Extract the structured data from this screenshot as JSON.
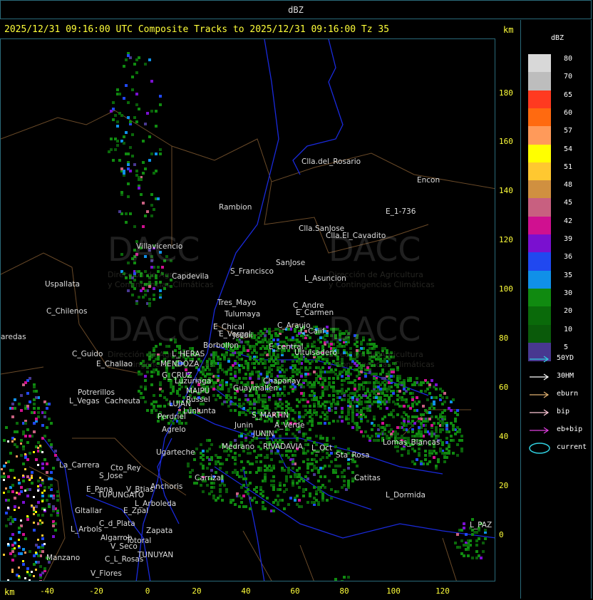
{
  "window_title": "dBZ",
  "header": "2025/12/31 09:16:00 UTC Composite Tracks to 2025/12/31 09:16:00 Tz 35",
  "km_label": "km",
  "y_ticks": [
    "180",
    "160",
    "140",
    "120",
    "100",
    "80",
    "60",
    "40",
    "20",
    "0"
  ],
  "x_ticks": [
    "-40",
    "-20",
    "0",
    "20",
    "40",
    "60",
    "80",
    "100",
    "120"
  ],
  "scale": {
    "title": "dBZ",
    "entries": [
      {
        "label": "80",
        "color": "#d8d8d8"
      },
      {
        "label": "70",
        "color": "#bdbdbd"
      },
      {
        "label": "65",
        "color": "#ff3a20"
      },
      {
        "label": "60",
        "color": "#ff6a10"
      },
      {
        "label": "57",
        "color": "#ff9a5a"
      },
      {
        "label": "54",
        "color": "#ffff00"
      },
      {
        "label": "51",
        "color": "#ffc830"
      },
      {
        "label": "48",
        "color": "#d09040"
      },
      {
        "label": "45",
        "color": "#c86080"
      },
      {
        "label": "42",
        "color": "#d01090"
      },
      {
        "label": "39",
        "color": "#7a10d0"
      },
      {
        "label": "36",
        "color": "#2048f0"
      },
      {
        "label": "35",
        "color": "#1090e8"
      },
      {
        "label": "30",
        "color": "#108a10"
      },
      {
        "label": "20",
        "color": "#0a6a0a"
      },
      {
        "label": "10",
        "color": "#0a5a0a"
      },
      {
        "label": "5",
        "color": "#483890"
      }
    ]
  },
  "legend": [
    {
      "label": "50YD",
      "color": "#30d0e0",
      "type": "arrow"
    },
    {
      "label": "30HM",
      "color": "#ffffff",
      "type": "arrow"
    },
    {
      "label": "eburn",
      "color": "#e0b070",
      "type": "arrow"
    },
    {
      "label": "bip",
      "color": "#ffc8d8",
      "type": "arrow"
    },
    {
      "label": "eb+bip",
      "color": "#e040e0",
      "type": "arrow"
    },
    {
      "label": "current",
      "color": "#30d0e0",
      "type": "ellipse"
    }
  ],
  "places": [
    "Clla.del_Rosario",
    "Encon",
    "Rambion",
    "E_1-736",
    "Clla.SanJose",
    "Clla.El_Cavadito",
    "Villavicencio",
    "Capdevila",
    "S_Francisco",
    "SanJose",
    "L_Asuncion",
    "Uspallata",
    "Tres_Mayo",
    "C_Andre",
    "C_Chilenos",
    "Tulumaya",
    "E_Carmen",
    "E_Chical",
    "C_Araujo",
    "Jocoli",
    "L_Calif",
    "E_Vergel",
    "E_central",
    "Borbollon",
    "L_HERAS",
    "Ultuisadero",
    "C_Guido",
    "E_Challao",
    "MENDOZA",
    "G_CRUZ",
    "Guaymallen",
    "Luzuriaga",
    "Chapanay",
    "Potrerillos",
    "MAIPU",
    "Russel",
    "L_Vegas",
    "Cacheuta",
    "LUJAN",
    "Lunlunta",
    "Perdriel",
    "S_MARTIN",
    "Agrelo",
    "A_Verde",
    "JUNIN",
    "Ugarteche",
    "RIVADAVIA",
    "L_Oct",
    "La_Carrera",
    "Cto_Rey",
    "S_Jose",
    "Anchoris",
    "Lomas_Blancas",
    "Carrizal",
    "Catitas",
    "E_Pena",
    "V_Btias",
    "TUPUNGATO",
    "L_Arboleda",
    "L_Dormida",
    "Gltallar",
    "E_Zpal",
    "C_d_Plata",
    "L_Arbols",
    "Zapata",
    "Algarrob",
    "V_Seco",
    "Totoral",
    "TUNUYAN",
    "L_PAZ",
    "Manzano",
    "C_L_Rosas",
    "V_Flores",
    "aredas",
    "Medrano",
    "Junin",
    "Sta_Rosa"
  ],
  "watermark": {
    "brand": "DACC",
    "subtitle_1": "Dirección de Agricultura",
    "subtitle_2": "y Contingencias Climáticas"
  }
}
